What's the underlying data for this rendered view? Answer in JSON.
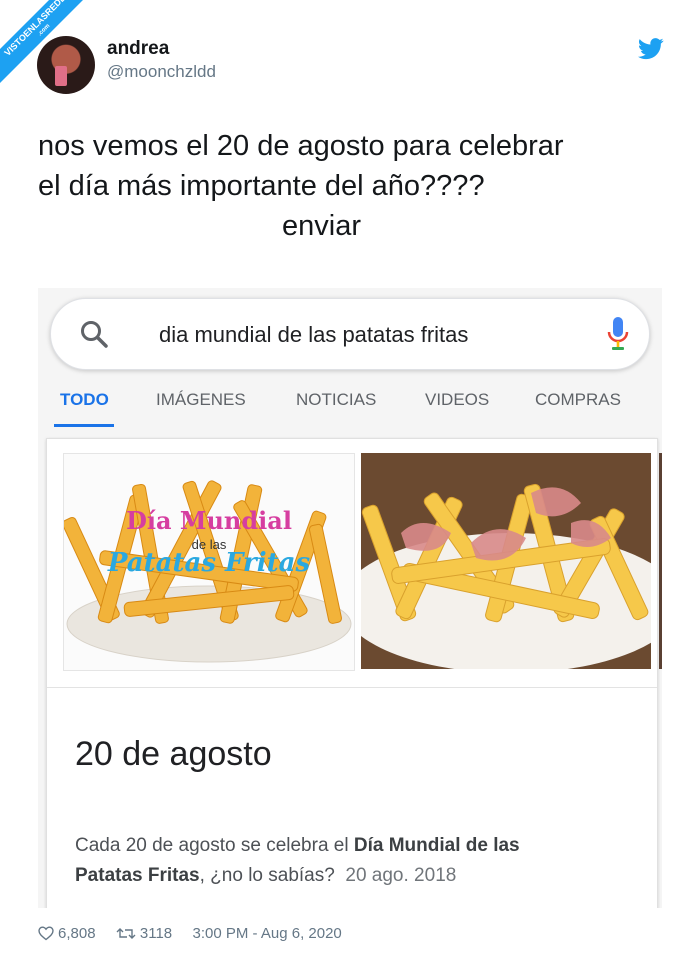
{
  "watermark": {
    "text": "VISTOENLASREDES",
    "sub": ".com"
  },
  "tweet": {
    "name": "andrea",
    "handle": "@moonchzldd",
    "lines": [
      "nos vemos el 20 de agosto para celebrar",
      "el día más importante del año????",
      "enviar"
    ],
    "likes": "6,808",
    "retweets": "3118",
    "timestamp": "3:00 PM - Aug 6, 2020"
  },
  "google": {
    "query": "dia mundial de las patatas fritas",
    "tabs": [
      "TODO",
      "IMÁGENES",
      "NOTICIAS",
      "VIDEOS",
      "COMPRAS"
    ],
    "active_tab": "TODO",
    "image1_text": {
      "line1": "Día Mundial",
      "line2": "de las",
      "line3": "Patatas Fritas"
    },
    "result_title": "20 de agosto",
    "snippet": {
      "part1": "Cada 20 de agosto se celebra el ",
      "bold1": "Día Mundial de las",
      "bold2": "Patatas Fritas",
      "part2": ", ¿no lo sabías?",
      "date": "20 ago. 2018"
    }
  },
  "colors": {
    "twitter_blue": "#1da1f2",
    "google_blue": "#1a73e8"
  }
}
